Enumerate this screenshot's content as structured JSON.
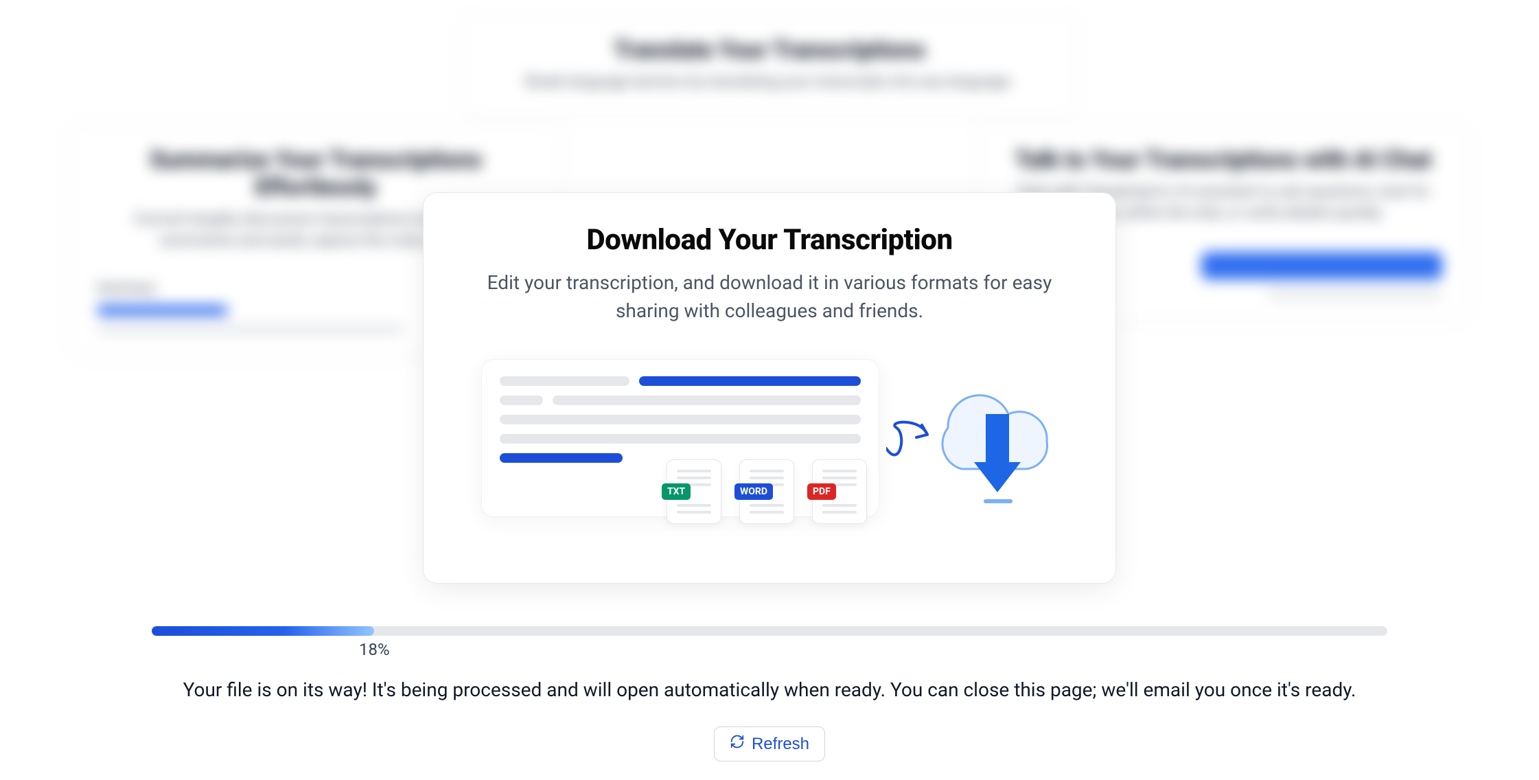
{
  "background": {
    "top": {
      "title": "Translate Your Transcriptions",
      "desc": "Break language barriers by translating your transcripts into any language."
    },
    "left": {
      "title": "Summarize Your Transcriptions Effortlessly",
      "desc": "Convert lengthy discussion transcriptions into concise summaries and easily capture the main points.",
      "panel_label": "Summary"
    },
    "right": {
      "title": "Talk to Your Transcriptions with AI Chat",
      "desc": "Chat with Transkriptor's AI assistant to ask questions, look for answers within the chat, or verify details quickly."
    }
  },
  "modal": {
    "title": "Download Your Transcription",
    "subtitle": "Edit your transcription, and download it in various formats for easy sharing with colleagues and friends.",
    "formats": {
      "txt": "TXT",
      "word": "WORD",
      "pdf": "PDF"
    }
  },
  "progress": {
    "percent": 18,
    "percent_label": "18%",
    "fill_width": "18%",
    "label_left": "18%"
  },
  "status": {
    "message": "Your file is on its way! It's being processed and will open automatically when ready. You can close this page; we'll email you once it's ready."
  },
  "actions": {
    "refresh": "Refresh"
  }
}
